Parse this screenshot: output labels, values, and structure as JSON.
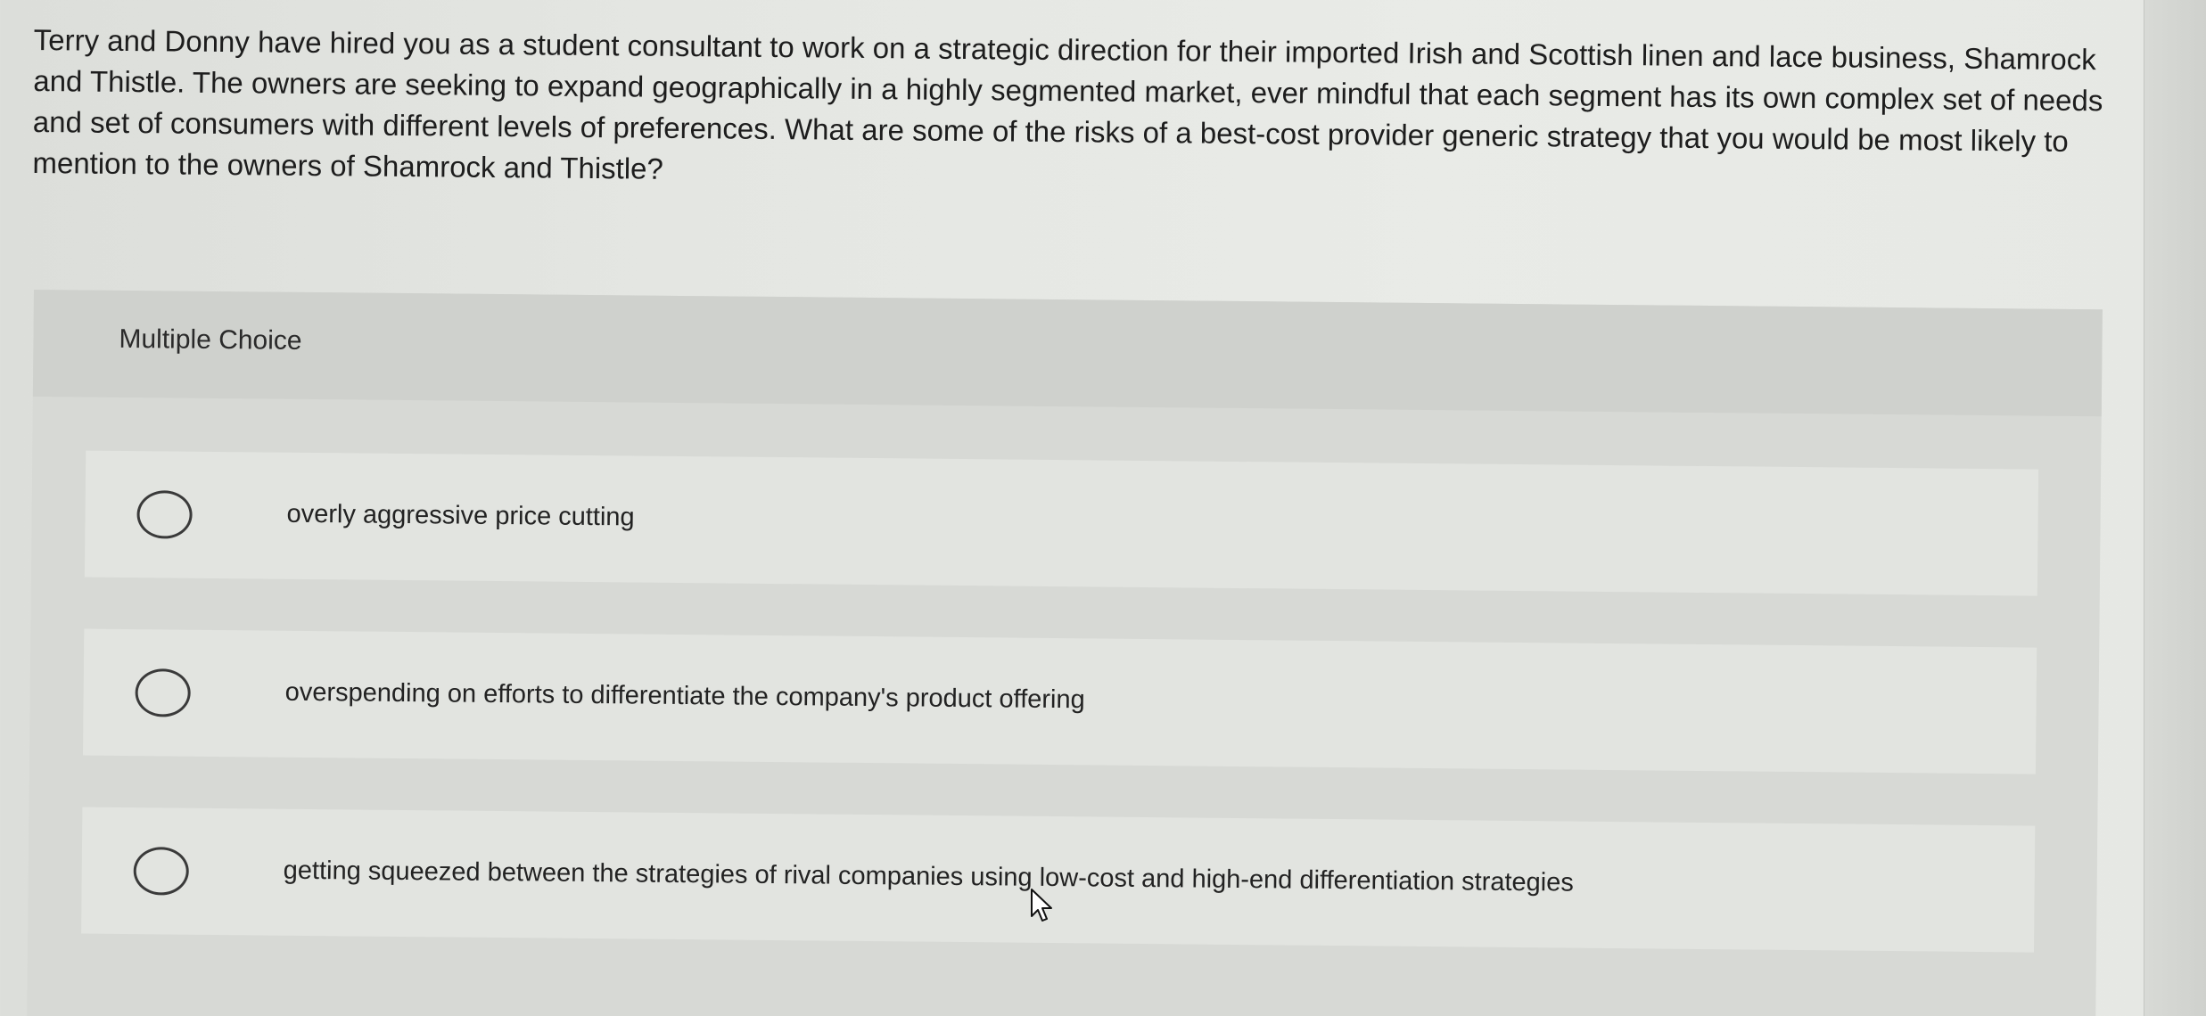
{
  "question": {
    "text": "Terry and Donny have hired you as a student consultant to work on a strategic direction for their imported Irish and Scottish linen and lace business, Shamrock and Thistle. The owners are seeking to expand geographically in a highly segmented market, ever mindful that each segment has its own complex set of needs and set of consumers with different levels of preferences. What are some of the risks of a best-cost provider generic strategy that you would be most likely to mention to the owners of Shamrock and Thistle?"
  },
  "multiple_choice": {
    "title": "Multiple Choice",
    "options": [
      {
        "label": "overly aggressive price cutting",
        "selected": false
      },
      {
        "label": "overspending on efforts to differentiate the company's product offering",
        "selected": false
      },
      {
        "label": "getting squeezed between the strategies of rival companies using low-cost and high-end differentiation strategies",
        "selected": false
      }
    ]
  },
  "colors": {
    "background": "#e6e8e4",
    "card": "#d7d9d5",
    "option": "#e2e4e0",
    "text": "#1d1d1d"
  }
}
